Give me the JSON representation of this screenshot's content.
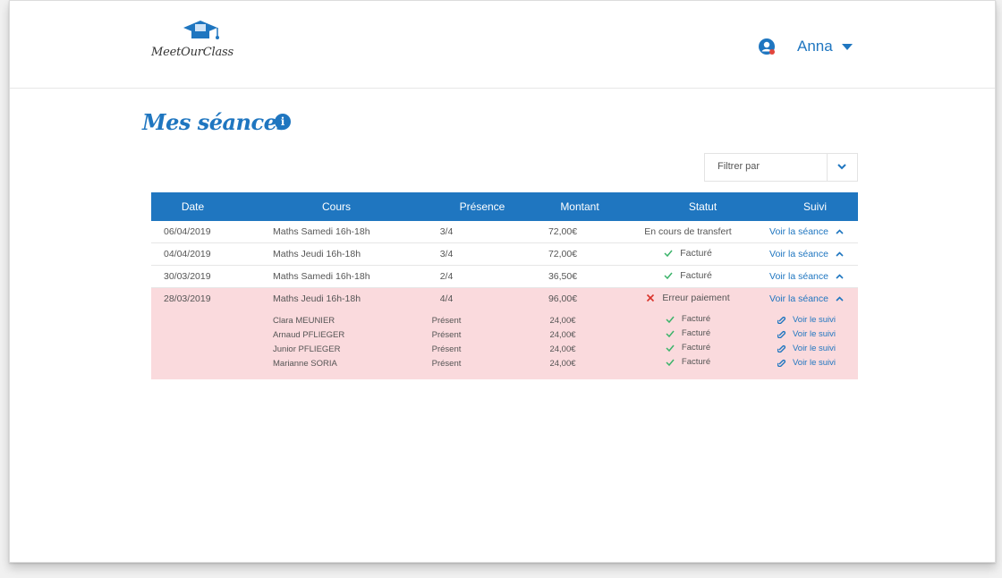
{
  "brand": {
    "logo_text": "MeetOurClass"
  },
  "user": {
    "name": "Anna"
  },
  "page": {
    "title": "Mes séances",
    "info_icon": "info-icon"
  },
  "filter": {
    "label": "Filtrer par"
  },
  "table": {
    "headers": [
      "Date",
      "Cours",
      "Présence",
      "Montant",
      "Statut",
      "Suivi"
    ],
    "rows": [
      {
        "date": "06/04/2019",
        "cours": "Maths Samedi 16h-18h",
        "presence": "3/4",
        "montant": "72,00€",
        "statut": "En cours de transfert",
        "status_icon": "none",
        "suivi": "Voir la séance"
      },
      {
        "date": "04/04/2019",
        "cours": "Maths Jeudi 16h-18h",
        "presence": "3/4",
        "montant": "72,00€",
        "statut": "Facturé",
        "status_icon": "check-icon",
        "suivi": "Voir la séance"
      },
      {
        "date": "30/03/2019",
        "cours": "Maths Samedi 16h-18h",
        "presence": "2/4",
        "montant": "36,50€",
        "statut": "Facturé",
        "status_icon": "check-icon",
        "suivi": "Voir la séance"
      },
      {
        "date": "28/03/2019",
        "cours": "Maths Jeudi 16h-18h",
        "presence": "4/4",
        "montant": "96,00€",
        "statut": "Erreur paiement",
        "status_icon": "cross-icon",
        "suivi": "Voir la séance"
      }
    ],
    "details": [
      {
        "name": "Clara MEUNIER",
        "presence": "Présent",
        "montant": "24,00€",
        "statut": "Facturé",
        "suivi": "Voir le suivi"
      },
      {
        "name": "Arnaud PFLIEGER",
        "presence": "Présent",
        "montant": "24,00€",
        "statut": "Facturé",
        "suivi": "Voir le suivi"
      },
      {
        "name": "Junior PFLIEGER",
        "presence": "Présent",
        "montant": "24,00€",
        "statut": "Facturé",
        "suivi": "Voir le suivi"
      },
      {
        "name": "Marianne SORIA",
        "presence": "Présent",
        "montant": "24,00€",
        "statut": "Facturé",
        "suivi": "Voir le suivi"
      }
    ]
  },
  "colors": {
    "primary": "#1f76c0",
    "error_row": "#fadadd",
    "check": "#3bb36a",
    "cross": "#d9342b"
  }
}
